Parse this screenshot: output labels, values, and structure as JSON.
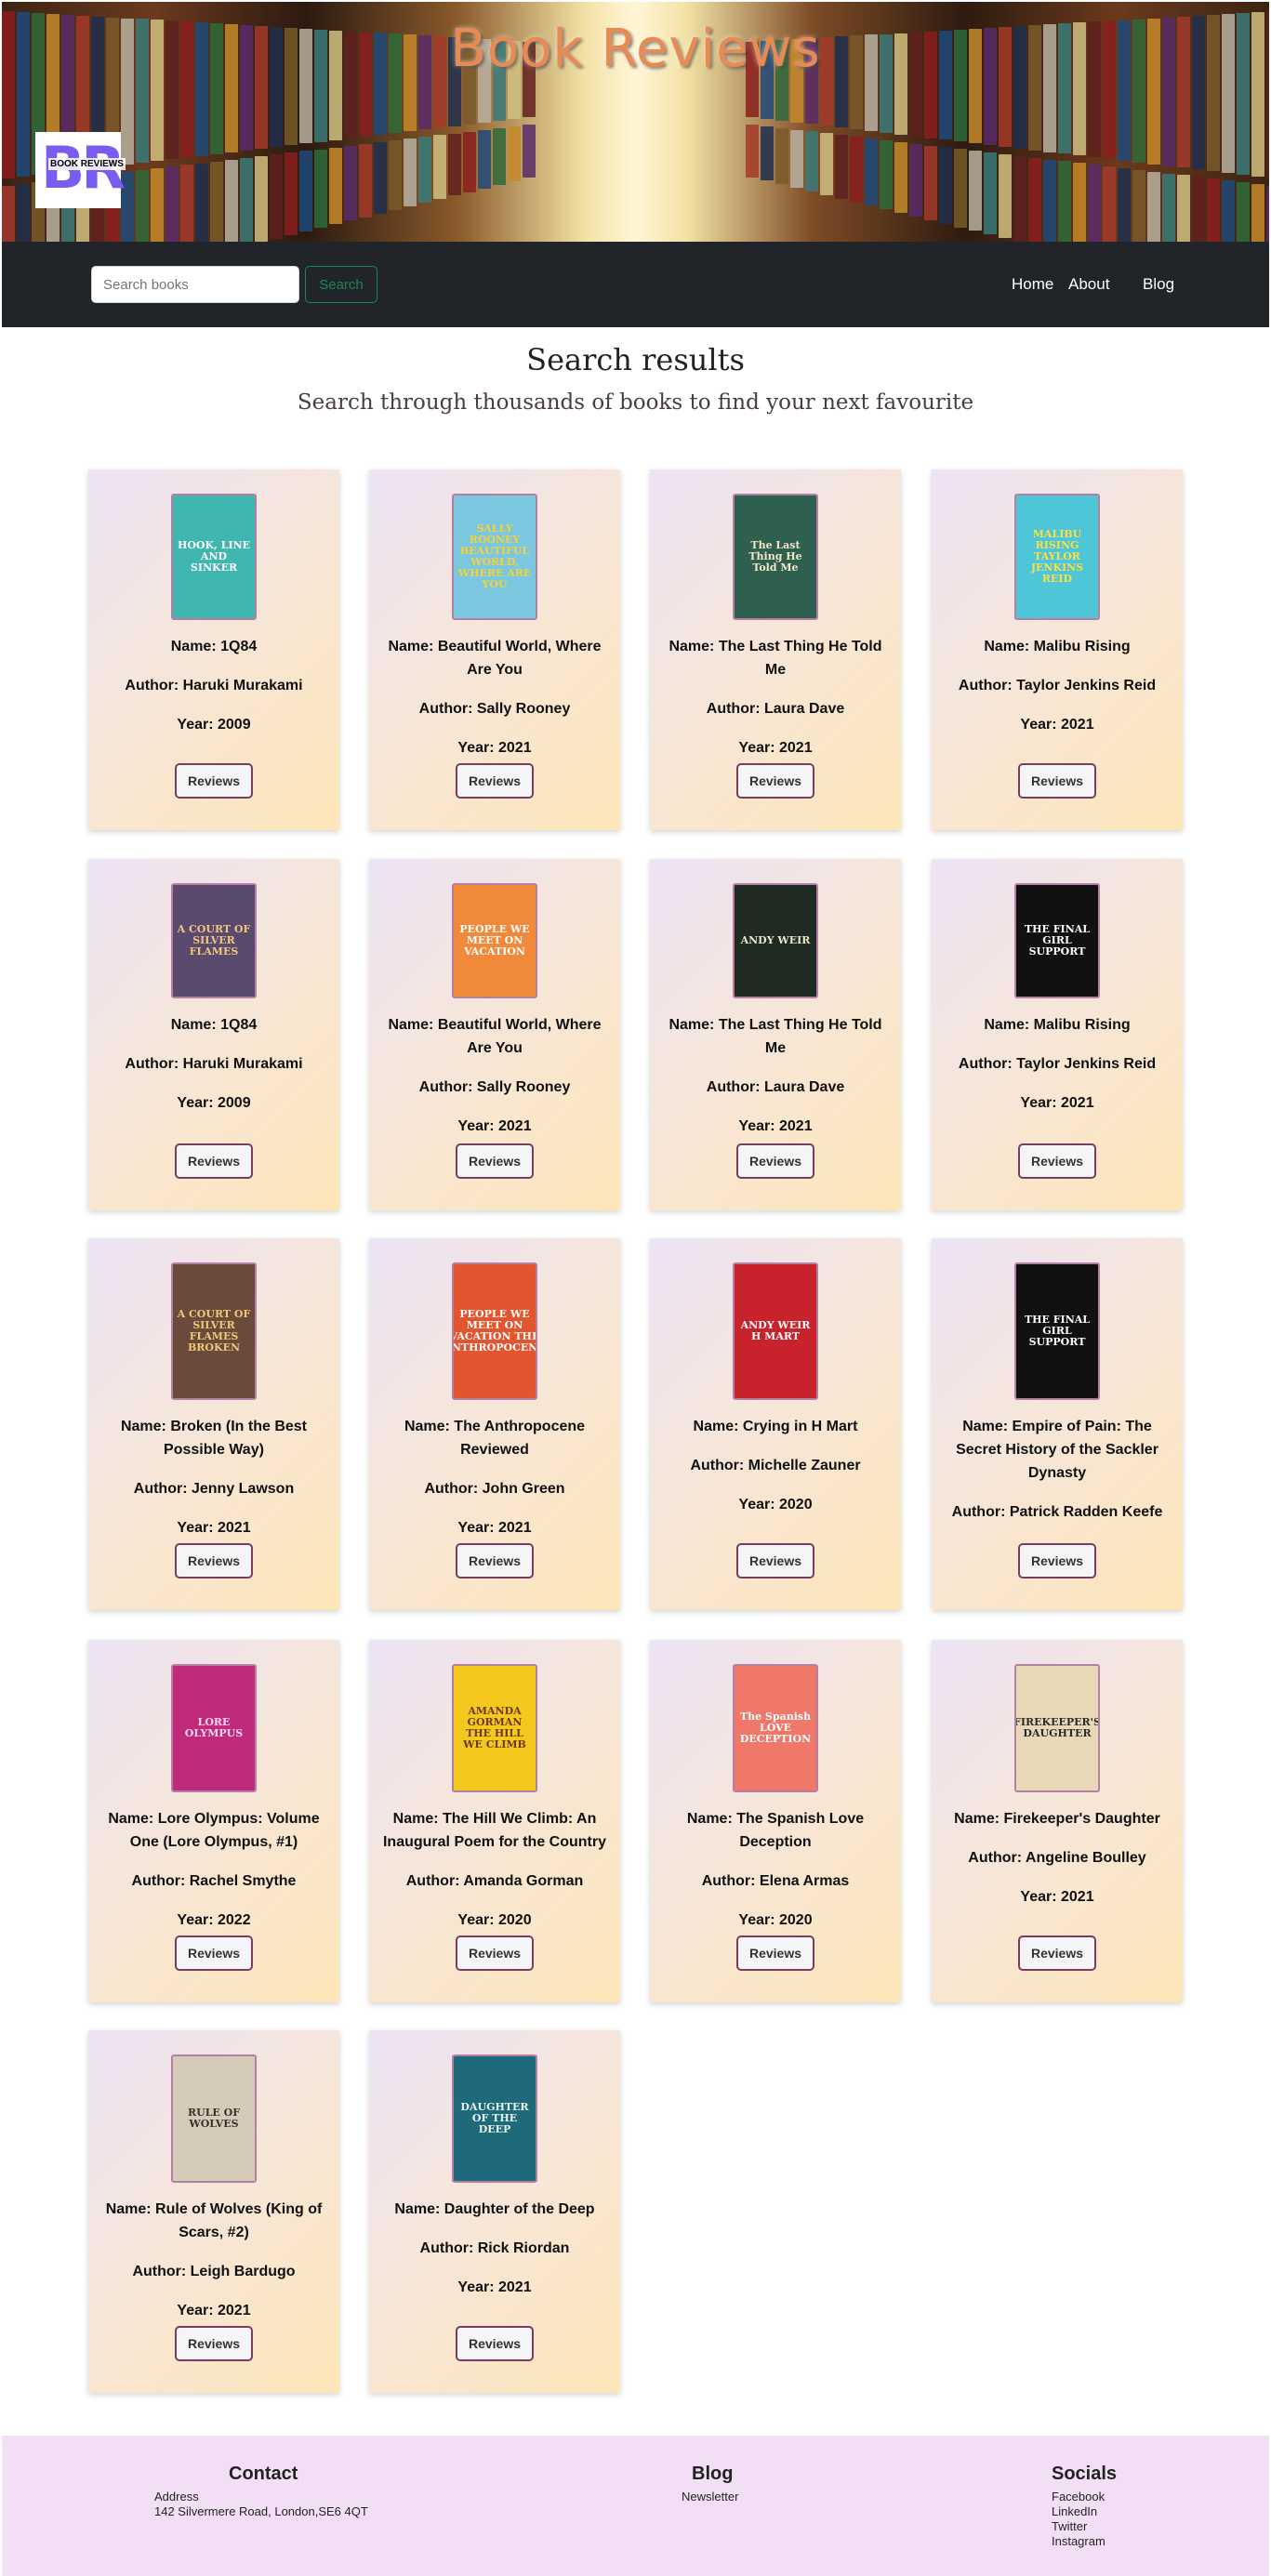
{
  "header": {
    "title": "Book Reviews",
    "logo_letters": "BR",
    "logo_text": "BOOK REVIEWS"
  },
  "navbar": {
    "search_placeholder": "Search books",
    "search_button": "Search",
    "links": [
      "Home",
      "About",
      "Blog"
    ]
  },
  "main": {
    "title": "Search results",
    "subtitle": "Search through thousands of books to find your next favourite",
    "reviews_label": "Reviews",
    "name_prefix": "Name: ",
    "author_prefix": "Author: ",
    "year_prefix": "Year: ",
    "books": [
      {
        "name": "1Q84",
        "author": "Haruki Murakami",
        "year": "2009",
        "cover_text": "HOOK, LINE AND SINKER",
        "cover_bg": "#3fb6b0",
        "cover_fg": "#ffffff"
      },
      {
        "name": "Beautiful World, Where Are You",
        "author": "Sally Rooney",
        "year": "2021",
        "cover_text": "SALLY ROONEY BEAUTIFUL WORLD, WHERE ARE YOU",
        "cover_bg": "#7cc7e0",
        "cover_fg": "#f5d23a"
      },
      {
        "name": "The Last Thing He Told Me",
        "author": "Laura Dave",
        "year": "2021",
        "cover_text": "The Last Thing He Told Me",
        "cover_bg": "#2f5f4f",
        "cover_fg": "#f2e8c8"
      },
      {
        "name": "Malibu Rising",
        "author": "Taylor Jenkins Reid",
        "year": "2021",
        "cover_text": "MALIBU RISING TAYLOR JENKINS REID",
        "cover_bg": "#4fc6d8",
        "cover_fg": "#f7e04a"
      },
      {
        "name": "1Q84",
        "author": "Haruki Murakami",
        "year": "2009",
        "cover_text": "A COURT OF SILVER FLAMES",
        "cover_bg": "#5a4a6e",
        "cover_fg": "#f0c77a"
      },
      {
        "name": "Beautiful World, Where Are You",
        "author": "Sally Rooney",
        "year": "2021",
        "cover_text": "PEOPLE WE MEET ON VACATION",
        "cover_bg": "#f08a3a",
        "cover_fg": "#ffffff"
      },
      {
        "name": "The Last Thing He Told Me",
        "author": "Laura Dave",
        "year": "2021",
        "cover_text": "ANDY WEIR",
        "cover_bg": "#1f2a22",
        "cover_fg": "#e8e8c8"
      },
      {
        "name": "Malibu Rising",
        "author": "Taylor Jenkins Reid",
        "year": "2021",
        "cover_text": "THE FINAL GIRL SUPPORT",
        "cover_bg": "#111111",
        "cover_fg": "#ffffff"
      },
      {
        "name": "Broken (In the Best Possible Way)",
        "author": "Jenny Lawson",
        "year": "2021",
        "cover_text": "A COURT OF SILVER FLAMES BROKEN",
        "cover_bg": "#6a4a3a",
        "cover_fg": "#f0c77a"
      },
      {
        "name": "The Anthropocene Reviewed",
        "author": "John Green",
        "year": "2021",
        "cover_text": "PEOPLE WE MEET ON VACATION THE ANTHROPOCENE",
        "cover_bg": "#e2552e",
        "cover_fg": "#ffffff"
      },
      {
        "name": "Crying in H Mart",
        "author": "Michelle Zauner",
        "year": "2020",
        "cover_text": "ANDY WEIR H MART",
        "cover_bg": "#c8232d",
        "cover_fg": "#ffffff"
      },
      {
        "name": "Empire of Pain: The Secret History of the Sackler Dynasty",
        "author": "Patrick Radden Keefe",
        "year": "2021",
        "cover_text": "THE FINAL GIRL SUPPORT",
        "cover_bg": "#111111",
        "cover_fg": "#ffffff"
      },
      {
        "name": "Lore Olympus: Volume One (Lore Olympus, #1)",
        "author": "Rachel Smythe",
        "year": "2022",
        "cover_text": "LORE OLYMPUS",
        "cover_bg": "#c02a7a",
        "cover_fg": "#ffd6f0"
      },
      {
        "name": "The Hill We Climb: An Inaugural Poem for the Country",
        "author": "Amanda Gorman",
        "year": "2020",
        "cover_text": "AMANDA GORMAN THE HILL WE CLIMB",
        "cover_bg": "#f5c81e",
        "cover_fg": "#6a3a1a"
      },
      {
        "name": "The Spanish Love Deception",
        "author": "Elena Armas",
        "year": "2020",
        "cover_text": "The Spanish LOVE DECEPTION",
        "cover_bg": "#f0786a",
        "cover_fg": "#ffffff"
      },
      {
        "name": "Firekeeper's Daughter",
        "author": "Angeline Boulley",
        "year": "2021",
        "cover_text": "FIREKEEPER'S DAUGHTER",
        "cover_bg": "#e8d8b8",
        "cover_fg": "#2a2a2a"
      },
      {
        "name": "Rule of Wolves (King of Scars, #2)",
        "author": "Leigh Bardugo",
        "year": "2021",
        "cover_text": "RULE OF WOLVES",
        "cover_bg": "#d6cbb8",
        "cover_fg": "#3a3028"
      },
      {
        "name": "Daughter of the Deep",
        "author": "Rick Riordan",
        "year": "2021",
        "cover_text": "DAUGHTER OF THE DEEP",
        "cover_bg": "#1e6a7a",
        "cover_fg": "#e8f4f0"
      }
    ]
  },
  "footer": {
    "contact_title": "Contact",
    "contact_address_label": "Address",
    "contact_address": "142 Silvermere Road, London,SE6 4QT",
    "blog_title": "Blog",
    "blog_newsletter": "Newsletter",
    "socials_title": "Socials",
    "socials": [
      "Facebook",
      "LinkedIn",
      "Twitter",
      "Instagram"
    ]
  }
}
